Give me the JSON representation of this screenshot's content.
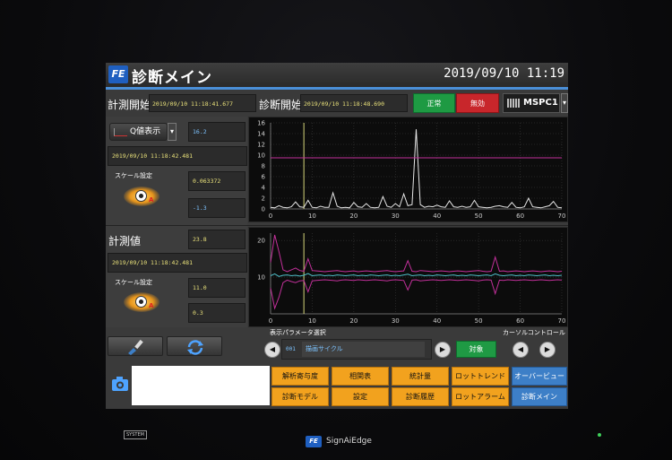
{
  "header": {
    "title": "診断メイン",
    "datetime": "2019/09/10 11:19",
    "logo": "FE"
  },
  "toolbar": {
    "measure_start_label": "計測開始",
    "measure_start_value": "2019/09/10 11:18:41.677",
    "diag_start_label": "診断開始",
    "diag_start_value": "2019/09/10 11:18:48.690",
    "status_normal": "正常",
    "status_invalid": "無効",
    "device_select": "MSPC1"
  },
  "q_panel": {
    "button_label": "Q値表示",
    "value": "16.2",
    "timestamp": "2019/09/10 11:18:42.481",
    "scale_label": "スケール設定",
    "scale_max": "0.063372",
    "scale_min": "-1.3"
  },
  "measured_panel": {
    "label": "計測値",
    "value": "23.8",
    "timestamp": "2019/09/10 11:18:42.481",
    "scale_label": "スケール設定",
    "scale_max": "11.0",
    "scale_min": "0.3"
  },
  "param_select": {
    "label": "表示パラメータ選択",
    "number": "001",
    "value": "描画サイクル",
    "target_button": "対象",
    "cursor_label": "カーソルコントロール"
  },
  "menu": {
    "row1": [
      "解析寄与度",
      "相関表",
      "統計量",
      "ロットトレンド",
      "オーバービュー"
    ],
    "row2": [
      "診断モデル",
      "設定",
      "診断履歴",
      "ロットアラーム",
      "診断メイン"
    ]
  },
  "bezel": {
    "system_label": "SYSTEM",
    "brand": "SignAiEdge",
    "brand_logo": "FE"
  },
  "colors": {
    "accent": "#4a8fd8",
    "green": "#1e9a43",
    "red": "#c8262b",
    "orange": "#f2a21e",
    "blue": "#3d7fc7",
    "magenta": "#c2309a",
    "cyan": "#4fbfc9"
  },
  "icons": [
    "camera-icon",
    "brush-icon",
    "refresh-icon",
    "chart-icon"
  ],
  "chart_data": [
    {
      "type": "line",
      "title": "",
      "xlabel": "",
      "ylabel": "",
      "xlim": [
        0,
        70
      ],
      "ylim": [
        0,
        16
      ],
      "x_ticks": [
        0,
        10,
        20,
        30,
        40,
        50,
        60,
        70
      ],
      "y_ticks": [
        0,
        2,
        4,
        6,
        8,
        10,
        12,
        14,
        16
      ],
      "grid": true,
      "cursor_x": 8,
      "series": [
        {
          "x": [
            0,
            1,
            2,
            3,
            4,
            5,
            6,
            7,
            8,
            9,
            10,
            11,
            12,
            13,
            14,
            15,
            16,
            17,
            18,
            19,
            20,
            21,
            22,
            23,
            24,
            25,
            26,
            27,
            28,
            29,
            30,
            31,
            32,
            33,
            34,
            35,
            36,
            37,
            38,
            39,
            40,
            41,
            42,
            43,
            44,
            45,
            46,
            47,
            48,
            49,
            50,
            51,
            52,
            53,
            54,
            55,
            56,
            57,
            58,
            59,
            60,
            61,
            62,
            63,
            64,
            65,
            66,
            67,
            68,
            69,
            70
          ],
          "y": [
            0.3,
            0.2,
            0.6,
            0.3,
            0.2,
            0.4,
            1.3,
            0.4,
            0.3,
            1.6,
            0.3,
            0.2,
            0.5,
            0.3,
            0.3,
            3.0,
            0.5,
            0.2,
            0.3,
            0.2,
            1.2,
            0.4,
            0.3,
            1.0,
            0.3,
            0.2,
            0.3,
            2.3,
            0.5,
            0.3,
            1.0,
            0.4,
            2.8,
            0.6,
            0.8,
            14.8,
            0.8,
            0.3,
            0.5,
            0.4,
            0.7,
            0.4,
            0.3,
            1.5,
            0.4,
            0.3,
            0.5,
            0.3,
            0.4,
            1.6,
            0.4,
            0.3,
            0.2,
            0.3,
            0.5,
            0.6,
            0.4,
            0.3,
            1.2,
            0.3,
            0.2,
            0.4,
            2.0,
            0.4,
            0.3,
            0.2,
            0.4,
            0.6,
            1.4,
            0.3,
            0.2
          ],
          "color": "#e6e6e6"
        },
        {
          "x": [
            0,
            70
          ],
          "y": [
            9.5,
            9.5
          ],
          "color": "#c2309a"
        }
      ]
    },
    {
      "type": "line",
      "title": "",
      "xlabel": "",
      "ylabel": "",
      "xlim": [
        0,
        70
      ],
      "ylim": [
        0,
        22
      ],
      "x_ticks": [
        0,
        10,
        20,
        30,
        40,
        50,
        60,
        70
      ],
      "y_ticks": [
        10,
        20
      ],
      "grid": true,
      "cursor_x": 8,
      "series": [
        {
          "x": [
            0,
            1,
            2,
            3,
            4,
            5,
            6,
            7,
            8,
            9,
            10,
            11,
            12,
            13,
            14,
            15,
            16,
            17,
            18,
            19,
            20,
            21,
            22,
            23,
            24,
            25,
            26,
            27,
            28,
            29,
            30,
            31,
            32,
            33,
            34,
            35,
            36,
            37,
            38,
            39,
            40,
            41,
            42,
            43,
            44,
            45,
            46,
            47,
            48,
            49,
            50,
            51,
            52,
            53,
            54,
            55,
            56,
            57,
            58,
            59,
            60,
            61,
            62,
            63,
            64,
            65,
            66,
            67,
            68,
            69,
            70
          ],
          "y": [
            14,
            21.5,
            17,
            12,
            11.5,
            12,
            12.5,
            11.8,
            11.6,
            15,
            11.8,
            11.7,
            11.6,
            11.5,
            11.6,
            11.7,
            11.8,
            11.6,
            11.5,
            11.6,
            11.7,
            11.5,
            11.6,
            11.7,
            11.6,
            11.5,
            11.6,
            11.7,
            11.8,
            11.6,
            11.5,
            11.6,
            11.7,
            14.5,
            11.6,
            11.5,
            11.8,
            11.7,
            11.6,
            11.5,
            11.6,
            11.7,
            11.6,
            11.5,
            11.6,
            11.7,
            11.6,
            11.5,
            11.6,
            11.7,
            11.8,
            11.6,
            11.5,
            11.6,
            15.5,
            11.6,
            11.7,
            11.5,
            11.6,
            11.7,
            11.6,
            11.5,
            11.6,
            11.7,
            11.6,
            11.5,
            11.6,
            11.7,
            11.6,
            11.5,
            11.6
          ],
          "color": "#c2309a"
        },
        {
          "x": [
            0,
            1,
            2,
            3,
            4,
            5,
            6,
            7,
            8,
            9,
            10,
            11,
            12,
            13,
            14,
            15,
            16,
            17,
            18,
            19,
            20,
            21,
            22,
            23,
            24,
            25,
            26,
            27,
            28,
            29,
            30,
            31,
            32,
            33,
            34,
            35,
            36,
            37,
            38,
            39,
            40,
            41,
            42,
            43,
            44,
            45,
            46,
            47,
            48,
            49,
            50,
            51,
            52,
            53,
            54,
            55,
            56,
            57,
            58,
            59,
            60,
            61,
            62,
            63,
            64,
            65,
            66,
            67,
            68,
            69,
            70
          ],
          "y": [
            7,
            1.5,
            4.5,
            8.5,
            9.2,
            8.8,
            8.5,
            9,
            9.1,
            6,
            9,
            9.1,
            9.2,
            9.3,
            9.2,
            9.1,
            9,
            9.2,
            9.3,
            9.2,
            9.1,
            9.3,
            9.2,
            9.1,
            9.2,
            9.3,
            9.2,
            9.1,
            9,
            9.2,
            9.3,
            9.2,
            9.1,
            6.5,
            9.2,
            9.3,
            9,
            9.1,
            9.2,
            9.3,
            9.2,
            9.1,
            9.2,
            9.3,
            9.2,
            9.1,
            9.2,
            9.3,
            9.2,
            9.1,
            9,
            9.2,
            9.3,
            9.2,
            5.5,
            9.2,
            9.1,
            9.3,
            9.2,
            9.1,
            9.2,
            9.3,
            9.2,
            9.1,
            9.2,
            9.3,
            9.2,
            9.1,
            9.2,
            9.3,
            9.2
          ],
          "color": "#c2309a"
        },
        {
          "x": [
            0,
            1,
            2,
            3,
            4,
            5,
            6,
            7,
            8,
            9,
            10,
            11,
            12,
            13,
            14,
            15,
            16,
            17,
            18,
            19,
            20,
            21,
            22,
            23,
            24,
            25,
            26,
            27,
            28,
            29,
            30,
            31,
            32,
            33,
            34,
            35,
            36,
            37,
            38,
            39,
            40,
            41,
            42,
            43,
            44,
            45,
            46,
            47,
            48,
            49,
            50,
            51,
            52,
            53,
            54,
            55,
            56,
            57,
            58,
            59,
            60,
            61,
            62,
            63,
            64,
            65,
            66,
            67,
            68,
            69,
            70
          ],
          "y": [
            10.4,
            10.9,
            10.2,
            10.5,
            10.6,
            10.4,
            10.5,
            10.3,
            10.5,
            11,
            10.4,
            10.5,
            10.6,
            10.4,
            10.5,
            10.4,
            10.6,
            10.5,
            10.4,
            10.5,
            10.6,
            10.4,
            10.5,
            10.4,
            10.6,
            10.5,
            10.4,
            10.5,
            10.6,
            10.4,
            10.5,
            10.4,
            10.6,
            10.8,
            10.4,
            10.5,
            10.6,
            10.4,
            10.5,
            10.4,
            10.6,
            10.5,
            10.4,
            10.5,
            10.6,
            10.4,
            10.5,
            10.4,
            10.6,
            10.5,
            10.4,
            10.5,
            10.6,
            10.4,
            10.9,
            10.5,
            10.4,
            10.5,
            10.6,
            10.4,
            10.5,
            10.4,
            10.6,
            10.5,
            10.4,
            10.5,
            10.6,
            10.4,
            10.5,
            10.4,
            10.5
          ],
          "color": "#4fbfc9"
        }
      ]
    }
  ]
}
